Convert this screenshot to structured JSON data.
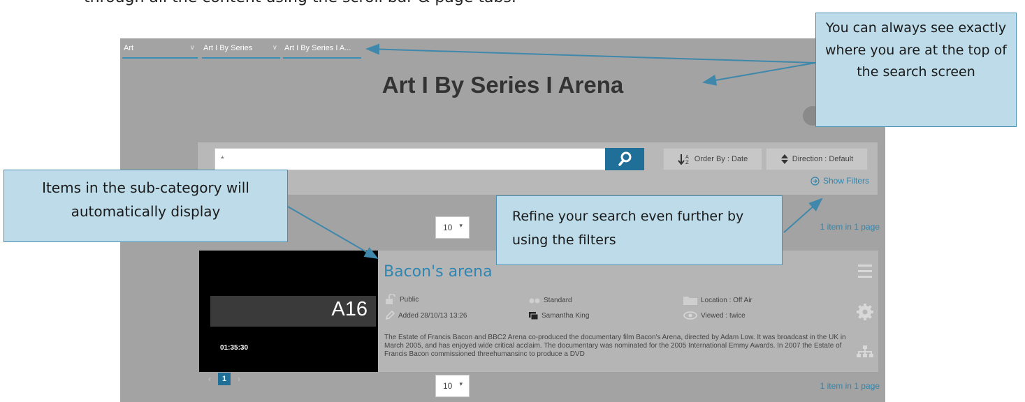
{
  "intro_text": "through all the content using the scroll bar & page tabs.",
  "breadcrumbs": [
    {
      "label": "Art"
    },
    {
      "label": "Art I By Series"
    },
    {
      "label": "Art I By Series I A..."
    }
  ],
  "page_title": "Art I By Series I Arena",
  "search": {
    "value": "*",
    "order_label": "Order By : Date",
    "direction_label": "Direction : Default",
    "show_filters_label": "Show Filters"
  },
  "paging_top": {
    "page_size": "10",
    "count": "1 item in 1 page"
  },
  "paging_bottom": {
    "page_size": "10",
    "count": "1 item in 1 page",
    "current_page": "1"
  },
  "result": {
    "title": "Bacon's arena",
    "thumb_code": "A16",
    "duration": "01:35:30",
    "access": "Public",
    "quality": "Standard",
    "location": "Location : Off Air",
    "added": "Added 28/10/13 13:26",
    "owner": "Samantha King",
    "views": "Viewed : twice",
    "description": "The Estate of Francis Bacon and BBC2 Arena co-produced the documentary film Bacon's Arena, directed by Adam Low. It was broadcast in the UK in March 2005, and has enjoyed wide critical acclaim. The documentary was nominated for the 2005 International Emmy Awards. In 2007 the Estate of Francis Bacon commissioned threehumansinc to produce a DVD"
  },
  "callouts": {
    "breadcrumb_note": "You can always see exactly where you are at the top of the search screen",
    "items_note": "Items in the sub-category will automatically display",
    "filters_note": "Refine your search even further by using the filters"
  },
  "colors": {
    "accent": "#2f86b0",
    "button": "#1f6f98",
    "callout_fill": "#bddbe9",
    "callout_border": "#4a8fb0",
    "background": "#a3a3a3"
  }
}
